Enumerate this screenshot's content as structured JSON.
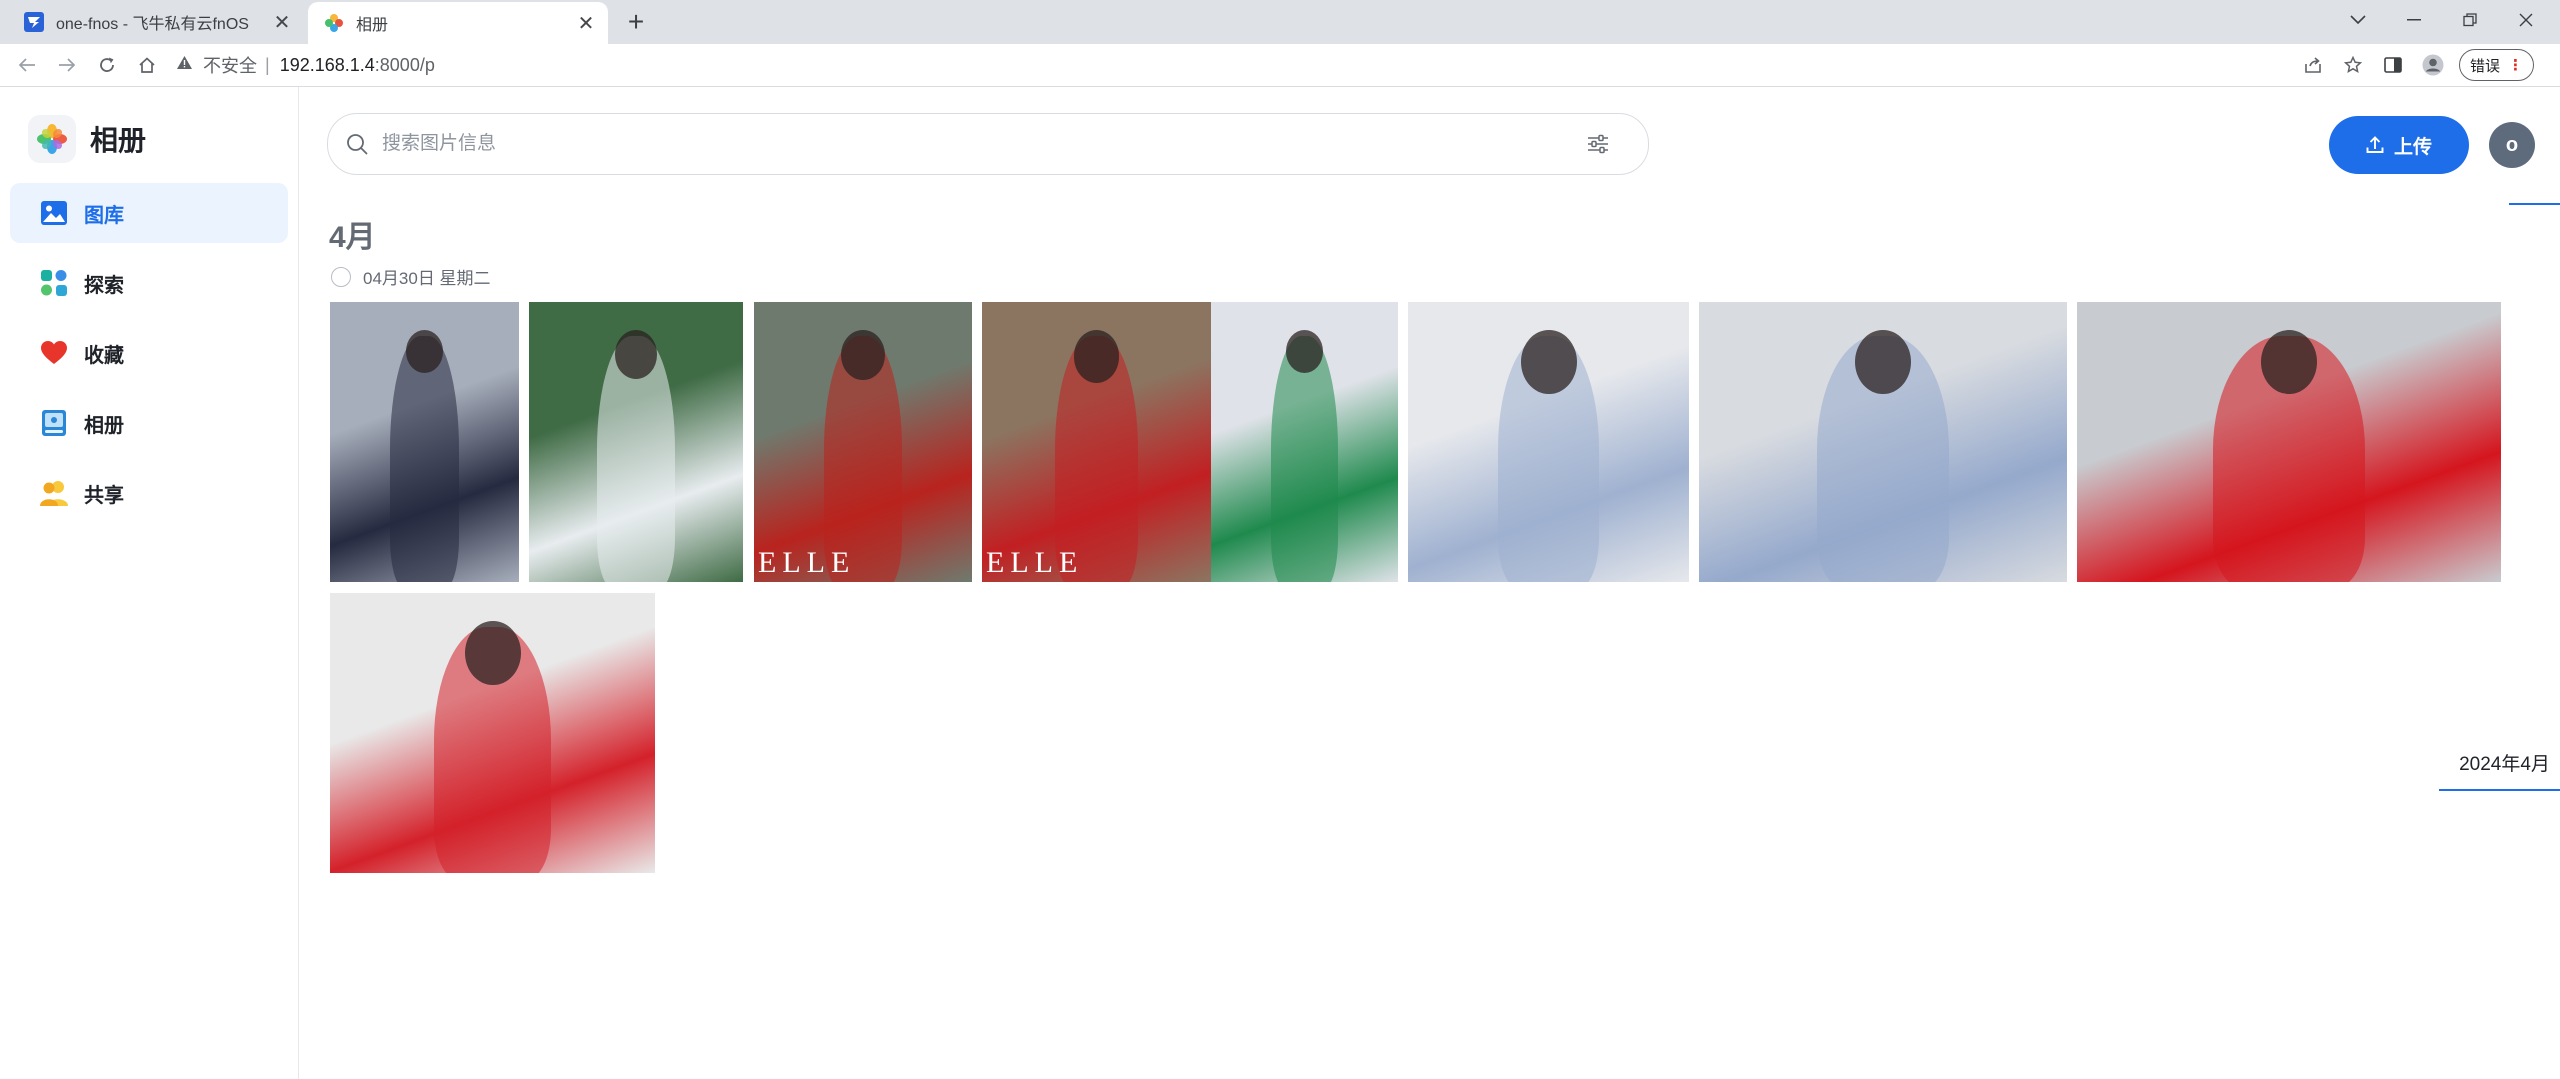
{
  "browser": {
    "tabs": [
      {
        "title": "one-fnos - 飞牛私有云fnOS",
        "active": false
      },
      {
        "title": "相册",
        "active": true
      }
    ],
    "new_tab": "+",
    "address": {
      "security_label": "不安全",
      "separator": "|",
      "url_host": "192.168.1.4",
      "url_path": ":8000/p"
    },
    "error_button": "错误"
  },
  "app": {
    "name": "相册",
    "nav": [
      {
        "label": "图库",
        "icon": "gallery-icon",
        "active": true
      },
      {
        "label": "探索",
        "icon": "explore-icon",
        "active": false
      },
      {
        "label": "收藏",
        "icon": "heart-icon",
        "active": false
      },
      {
        "label": "相册",
        "icon": "album-icon",
        "active": false
      },
      {
        "label": "共享",
        "icon": "share-users-icon",
        "active": false
      }
    ],
    "search_placeholder": "搜索图片信息",
    "upload_label": "上传",
    "avatar_initial": "o"
  },
  "gallery": {
    "month_heading": "4月",
    "date_label": "04月30日 星期二",
    "photos": [
      {
        "alt": "woman in dark dress seated",
        "colors": [
          "#a7aebb",
          "#262a40"
        ]
      },
      {
        "alt": "woman with hand at chin in greenery",
        "colors": [
          "#3f6b45",
          "#e8ecef"
        ],
        "overlay": ""
      },
      {
        "alt": "woman in red, magazine cover",
        "colors": [
          "#6f7a6e",
          "#b9231e"
        ],
        "overlay": "ELLE"
      },
      {
        "alt": "woman with red scarf, magazine cover",
        "colors": [
          "#8b7561",
          "#c21f22"
        ],
        "overlay": "ELLE"
      },
      {
        "alt": "woman in green dress at event",
        "colors": [
          "#dfe2e8",
          "#1f8a4d"
        ],
        "overlay": ""
      },
      {
        "alt": "legs in blue dress with heels",
        "colors": [
          "#e6e8ec",
          "#9fb1d0"
        ],
        "overlay": ""
      },
      {
        "alt": "legs in blue dress with heels",
        "colors": [
          "#d8dbe0",
          "#95a9cc"
        ],
        "overlay": ""
      },
      {
        "alt": "smiling woman in red top",
        "colors": [
          "#c8cbcf",
          "#d5151e"
        ],
        "overlay": ""
      },
      {
        "alt": "woman in red reclining on sofa",
        "colors": [
          "#e9e9e9",
          "#d4212a"
        ],
        "overlay": ""
      }
    ]
  },
  "timeline": {
    "label": "2024年4月"
  },
  "colors": {
    "accent": "#1d6ee8",
    "nav_active_bg": "#ebf3fe",
    "avatar_bg": "#5e6b7d"
  }
}
